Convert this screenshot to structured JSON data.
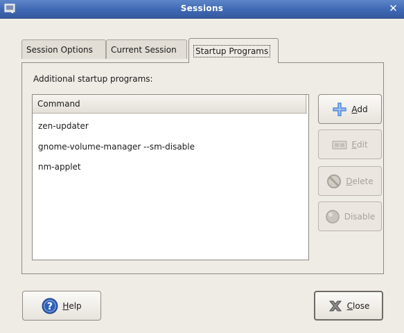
{
  "window": {
    "title": "Sessions"
  },
  "tabs": [
    {
      "label": "Session Options",
      "active": false
    },
    {
      "label": "Current Session",
      "active": false
    },
    {
      "label": "Startup Programs",
      "active": true
    }
  ],
  "panel": {
    "label": "Additional startup programs:",
    "column_header": "Command",
    "rows": [
      "zen-updater",
      "gnome-volume-manager --sm-disable",
      "nm-applet"
    ]
  },
  "side_buttons": {
    "add": {
      "mnemonic": "A",
      "rest": "dd",
      "enabled": true
    },
    "edit": {
      "mnemonic": "E",
      "rest": "dit",
      "enabled": false
    },
    "delete": {
      "mnemonic": "D",
      "rest": "elete",
      "enabled": false
    },
    "disable": {
      "label": "Disable",
      "enabled": false
    }
  },
  "footer": {
    "help": {
      "mnemonic": "H",
      "rest": "elp"
    },
    "close": {
      "mnemonic": "C",
      "rest": "lose"
    }
  },
  "icons": {
    "window": "window-icon",
    "close": "close-icon",
    "add": "plus-icon",
    "edit": "edit-icon",
    "delete": "delete-icon",
    "disable": "disable-icon",
    "help": "help-icon",
    "close_button": "x-icon"
  },
  "colors": {
    "titlebar": "#3f68b4",
    "background": "#efebe5",
    "help_blue": "#2f5fb5",
    "add_blue": "#3a78d8"
  }
}
